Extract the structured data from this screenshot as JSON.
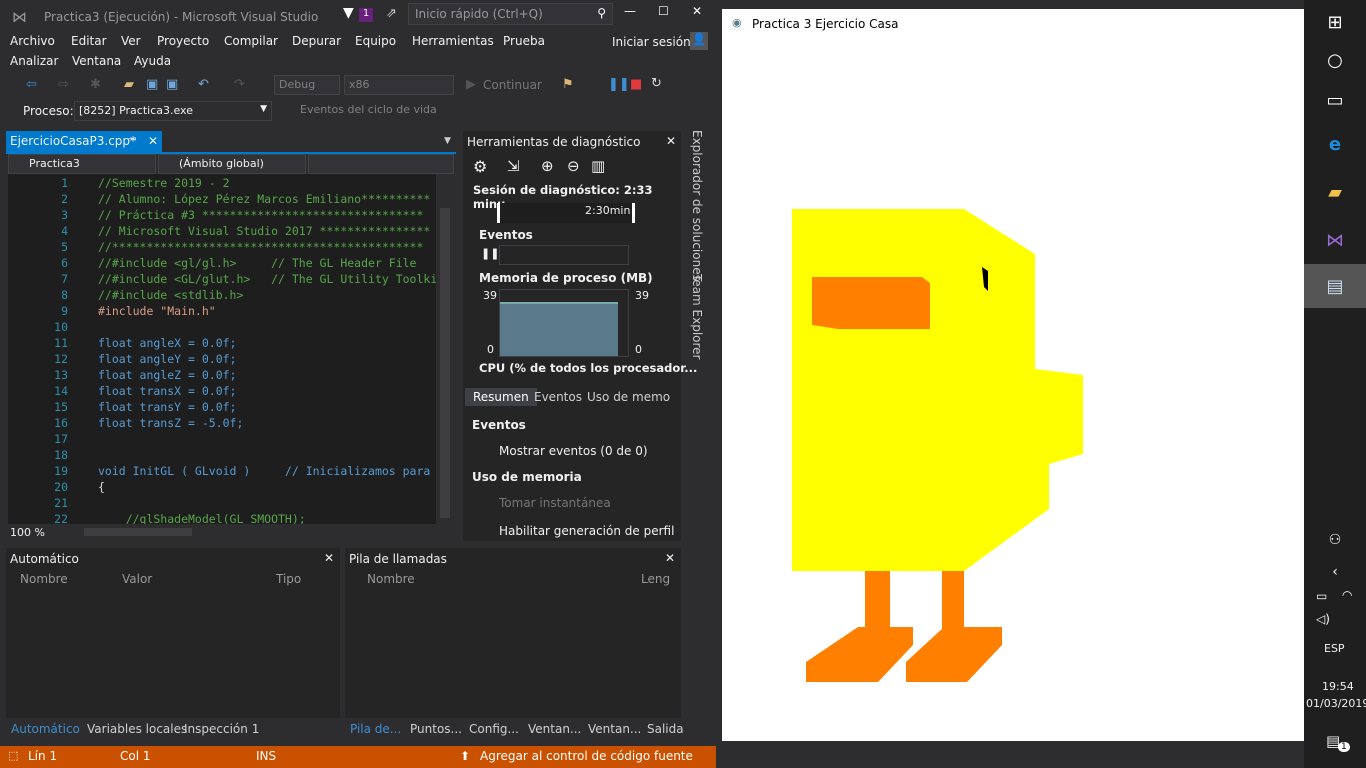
{
  "vs": {
    "title": "Practica3 (Ejecución) - Microsoft Visual Studio",
    "notif_count": "1",
    "quick_launch_placeholder": "Inicio rápido (Ctrl+Q)",
    "signin": "Iniciar sesión",
    "menu": [
      "Archivo",
      "Editar",
      "Ver",
      "Proyecto",
      "Compilar",
      "Depurar",
      "Equipo",
      "Herramientas",
      "Prueba",
      "Analizar",
      "Ventana",
      "Ayuda"
    ],
    "toolbar": {
      "config": "Debug",
      "platform": "x86",
      "continue": "Continuar"
    },
    "process_label": "Proceso:",
    "process_value": "[8252] Practica3.exe",
    "lifecycle": "Eventos del ciclo de vida",
    "editor": {
      "tab": "EjercicioCasaP3.cpp*",
      "scope_project": "Practica3",
      "scope_global": "(Ámbito global)",
      "zoom": "100 %",
      "lines": [
        "//Semestre 2019 - 2",
        "// Alumno: López Pérez Marcos Emiliano**********",
        "// Práctica #3 ********************************",
        "// Microsoft Visual Studio 2017 ****************",
        "//*********************************************",
        "//#include <gl/gl.h>     // The GL Header File",
        "//#include <GL/glut.h>   // The GL Utility Toolki",
        "//#include <stdlib.h>",
        "#include \"Main.h\"",
        "",
        "float angleX = 0.0f;",
        "float angleY = 0.0f;",
        "float angleZ = 0.0f;",
        "float transX = 0.0f;",
        "float transY = 0.0f;",
        "float transZ = -5.0f;",
        "",
        "",
        "void InitGL ( GLvoid )     // Inicializamos para",
        "{",
        "",
        "    //glShadeModel(GL_SMOOTH);"
      ]
    },
    "diag": {
      "title": "Herramientas de diagnóstico",
      "session": "Sesión de diagnóstico: 2:33 minu...",
      "time": "2:30min",
      "events": "Eventos",
      "memory": "Memoria de proceso (MB)",
      "mem_max_left": "39",
      "mem_max_right": "39",
      "mem_min_left": "0",
      "mem_min_right": "0",
      "cpu": "CPU (% de todos los procesador...",
      "tabs": [
        "Resumen",
        "Eventos",
        "Uso de memo"
      ],
      "events_header": "Eventos",
      "show_events": "Mostrar eventos (0 de 0)",
      "memory_header": "Uso de memoria",
      "snapshot": "Tomar instantánea",
      "profiling": "Habilitar generación de perfil"
    },
    "side_tabs": [
      "Explorador de soluciones",
      "Team Explorer"
    ],
    "auto": {
      "title": "Automático",
      "cols": [
        "Nombre",
        "Valor",
        "Tipo"
      ],
      "tabs": [
        "Automático",
        "Variables locales",
        "Inspección 1"
      ]
    },
    "stack": {
      "title": "Pila de llamadas",
      "cols": [
        "Nombre",
        "Leng"
      ],
      "tabs": [
        "Pila de...",
        "Puntos...",
        "Config...",
        "Ventan...",
        "Ventan...",
        "Salida"
      ]
    },
    "status": {
      "line": "Lín 1",
      "col": "Col 1",
      "mode": "INS",
      "source": "Agregar al control de código fuente"
    }
  },
  "glwin": {
    "title": "Practica 3 Ejercicio Casa",
    "colors": {
      "body": "#ffff00",
      "beak": "#ff8000",
      "eye": "#000000"
    }
  },
  "taskbar": {
    "lang": "ESP",
    "time": "19:54",
    "date": "01/03/2019",
    "notif": "1"
  }
}
